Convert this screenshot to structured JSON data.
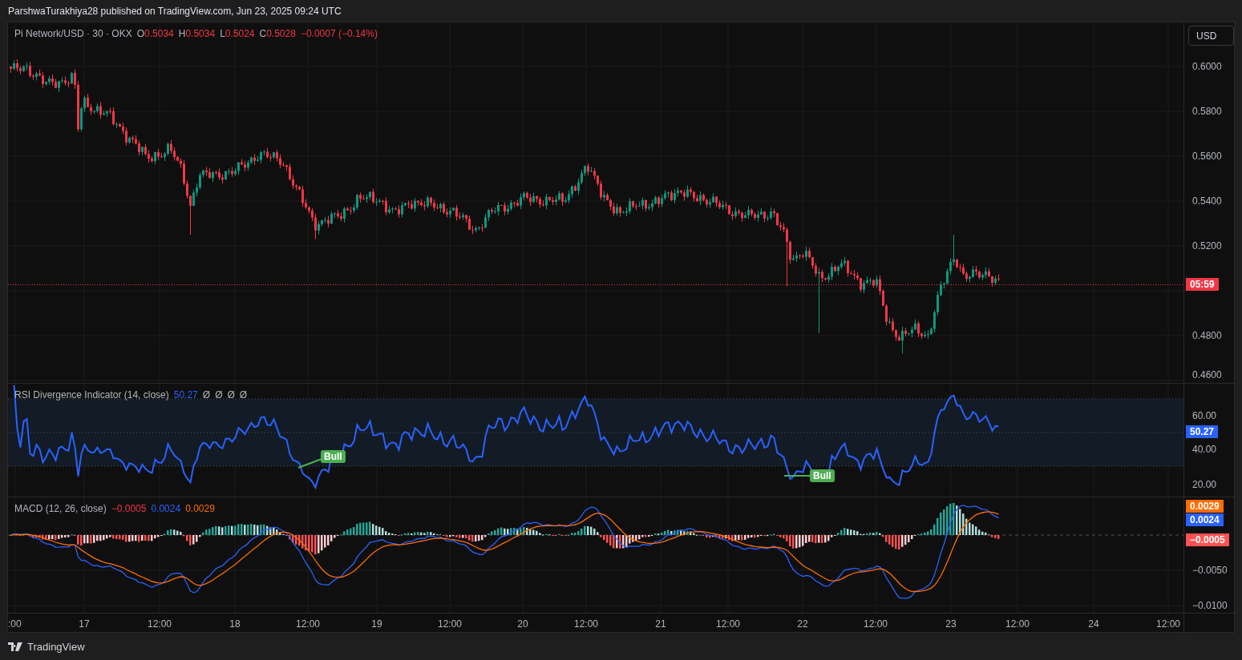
{
  "header": {
    "text": "ParshwaTurakhiya28 published on TradingView.com, Jun 23, 2025 09:24 UTC"
  },
  "price_pane": {
    "symbol": "Pi Network/USD · 30 · OKX",
    "fields": [
      {
        "label": "O",
        "value": "0.5034"
      },
      {
        "label": "H",
        "value": "0.5034"
      },
      {
        "label": "L",
        "value": "0.5024"
      },
      {
        "label": "C",
        "value": "0.5028"
      }
    ],
    "change": "−0.0007 (−0.14%)"
  },
  "price_axis": {
    "unit_button": "USD",
    "ticks": [
      "0.6000",
      "0.5800",
      "0.5600",
      "0.5400",
      "0.5200",
      "0.4800",
      "0.4600"
    ],
    "countdown_badge": "05:59"
  },
  "rsi_pane": {
    "title": "RSI Divergence Indicator (14, close)",
    "value": "50.27",
    "extra_values": [
      "Ø",
      "Ø",
      "Ø",
      "Ø"
    ],
    "ticks": [
      "60.00",
      "40.00",
      "20.00"
    ],
    "badge": "50.27",
    "signals": [
      {
        "text": "Bull"
      },
      {
        "text": "Bull"
      }
    ]
  },
  "macd_pane": {
    "title": "MACD (12, 26, close)",
    "values": [
      {
        "text": "−0.0005",
        "color": "#f23645"
      },
      {
        "text": "0.0024",
        "color": "#2962ff"
      },
      {
        "text": "0.0029",
        "color": "#ff6d00"
      }
    ],
    "ticks": [
      "−0.0050",
      "−0.0100"
    ],
    "badges": [
      {
        "text": "0.0029",
        "color": "#ff6d00"
      },
      {
        "text": "0.0024",
        "color": "#2962ff"
      },
      {
        "text": "−0.0005",
        "color": "#ff5252"
      }
    ]
  },
  "time_axis": {
    "labels": [
      ":00",
      "17",
      "12:00",
      "18",
      "12:00",
      "19",
      "12:00",
      "20",
      "12:00",
      "21",
      "12:00",
      "22",
      "12:00",
      "23",
      "12:00",
      "24",
      "12:00"
    ]
  },
  "footer": {
    "brand": "TradingView"
  }
}
